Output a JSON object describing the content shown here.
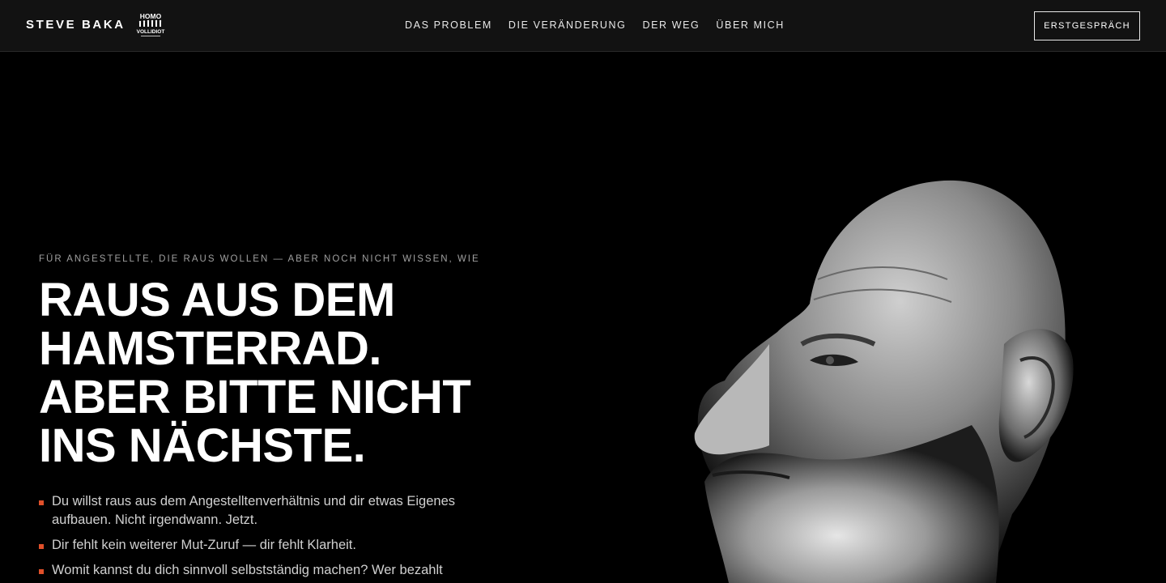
{
  "header": {
    "brand": "STEVE BAKA",
    "logo": {
      "line1": "HOMO",
      "line2": "VOLLIDIOT",
      "icon": "evolution-silhouettes-logo"
    },
    "nav": [
      {
        "label": "DAS PROBLEM"
      },
      {
        "label": "DIE VERÄNDERUNG"
      },
      {
        "label": "DER WEG"
      },
      {
        "label": "ÜBER MICH"
      }
    ],
    "cta_label": "ERSTGESPRÄCH"
  },
  "hero": {
    "eyebrow": "FÜR ANGESTELLTE, DIE RAUS WOLLEN — ABER NOCH NICHT WISSEN, WIE",
    "headline": [
      "RAUS AUS DEM",
      "HAMSTERRAD.",
      "ABER BITTE NICHT",
      "INS NÄCHSTE."
    ],
    "bullets": [
      "Du willst raus aus dem Angestelltenverhältnis und dir etwas Eigenes aufbauen. Nicht irgendwann. Jetzt.",
      "Dir fehlt kein weiterer Mut-Zuruf — dir fehlt Klarheit.",
      "Womit kannst du dich sinnvoll selbstständig machen? Wer bezahlt"
    ],
    "portrait_icon": "bald-bearded-man-portrait"
  },
  "colors": {
    "background": "#000000",
    "header_bg": "#121212",
    "accent": "#e0502a",
    "text": "#ffffff",
    "muted": "#a0a0a0"
  }
}
